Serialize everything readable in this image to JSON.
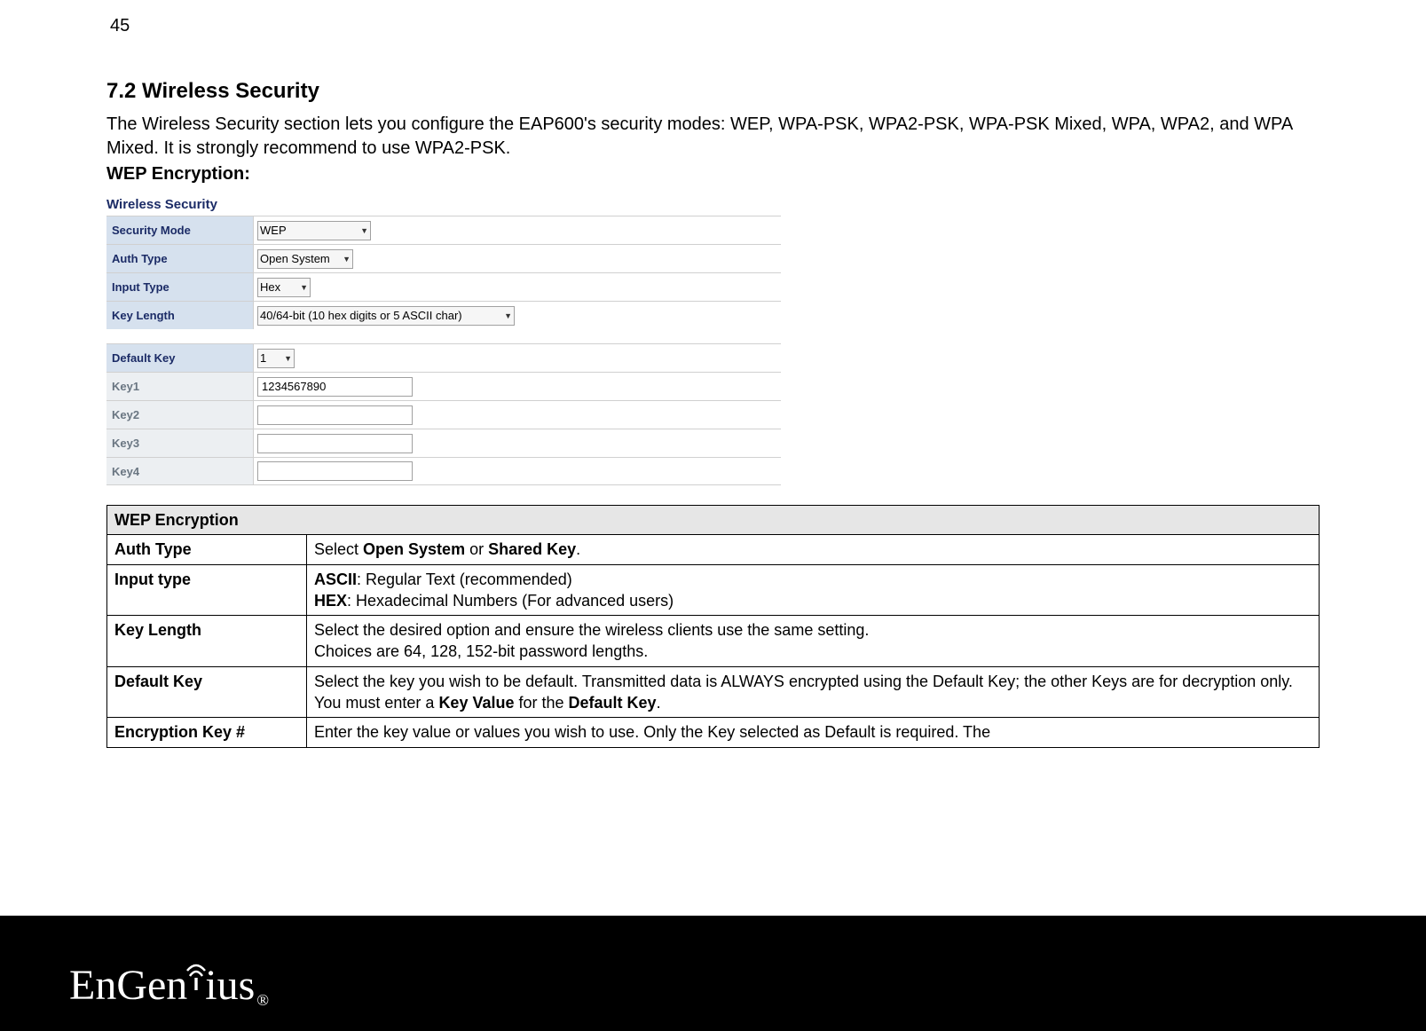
{
  "page_number": "45",
  "heading": "7.2   Wireless Security",
  "intro_text": "The Wireless Security section lets you configure the EAP600's security modes: WEP, WPA-PSK, WPA2-PSK, WPA-PSK Mixed, WPA, WPA2, and WPA Mixed. It is strongly recommend to use WPA2-PSK.",
  "subheading": "WEP Encryption:",
  "ws_box": {
    "title": "Wireless Security",
    "rows": {
      "security_mode_label": "Security Mode",
      "security_mode_value": "WEP",
      "auth_type_label": "Auth Type",
      "auth_type_value": "Open System",
      "input_type_label": "Input Type",
      "input_type_value": "Hex",
      "key_length_label": "Key Length",
      "key_length_value": "40/64-bit (10 hex digits or 5 ASCII char)",
      "default_key_label": "Default Key",
      "default_key_value": "1",
      "key1_label": "Key1",
      "key1_value": "1234567890",
      "key2_label": "Key2",
      "key2_value": "",
      "key3_label": "Key3",
      "key3_value": "",
      "key4_label": "Key4",
      "key4_value": ""
    }
  },
  "table": {
    "header": "WEP Encryption",
    "rows": [
      {
        "label": "Auth Type",
        "html": "Select <b>Open System</b> or <b>Shared Key</b>."
      },
      {
        "label": "Input type",
        "html": "<b>ASCII</b>: Regular Text (recommended)<br><b>HEX</b>: Hexadecimal Numbers (For advanced users)"
      },
      {
        "label": "Key Length",
        "html": "Select the desired option and ensure the wireless clients use the same setting.<br>Choices are 64, 128, 152-bit password lengths."
      },
      {
        "label": "Default Key",
        "html": "Select the key you wish to be default. Transmitted data is ALWAYS encrypted using the Default Key; the other Keys are for decryption only.<br>You must enter a <b>Key Value</b> for the <b>Default Key</b>."
      },
      {
        "label": "Encryption Key #",
        "html": "Enter the key value or values you wish to use. Only the Key selected as Default is required. The"
      }
    ]
  },
  "logo_text": {
    "en": "En",
    "gen": "Gen",
    "ius": "ius"
  }
}
